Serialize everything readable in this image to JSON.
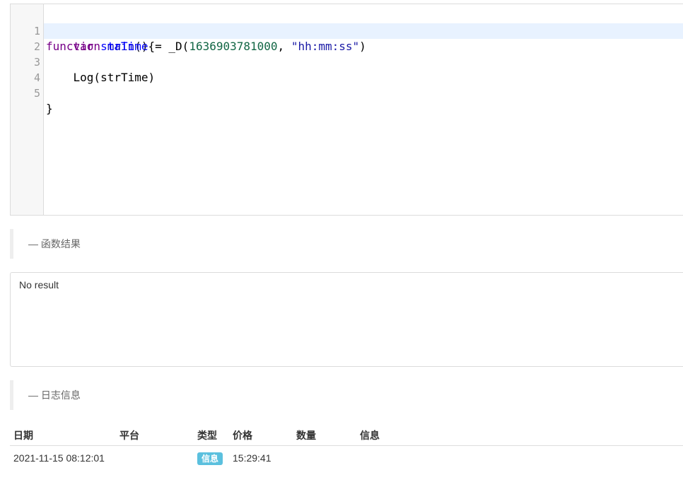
{
  "editor": {
    "lines": [
      {
        "num": "1"
      },
      {
        "num": "2"
      },
      {
        "num": "3"
      },
      {
        "num": "4"
      },
      {
        "num": "5"
      }
    ],
    "tokens": {
      "l1_kw": "function",
      "l1_fn": "main",
      "l1_rest": "(){",
      "l2_indent": "    ",
      "l2_kw": "var",
      "l2_var": "strTime",
      "l2_eq": " = _D(",
      "l2_num": "1636903781000",
      "l2_comma": ", ",
      "l2_str": "\"hh:mm:ss\"",
      "l2_close": ")",
      "l3_text": "    Log(strTime)",
      "l5_text": "}"
    }
  },
  "function_result_section": {
    "title": "— 函数结果"
  },
  "result": {
    "text": "No result"
  },
  "log_section": {
    "title": "— 日志信息"
  },
  "log_table": {
    "headers": [
      "日期",
      "平台",
      "类型",
      "价格",
      "数量",
      "信息"
    ],
    "rows": [
      {
        "date": "2021-11-15 08:12:01",
        "platform": "",
        "type": "信息",
        "price": "15:29:41",
        "amount": "",
        "info": ""
      }
    ]
  },
  "colors": {
    "badge": "#5bc0de",
    "active_line": "#e8f2ff"
  }
}
